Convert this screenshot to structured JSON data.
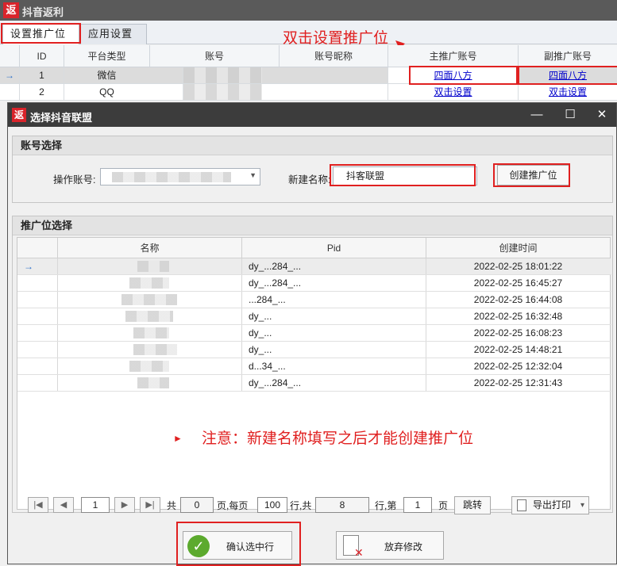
{
  "main": {
    "title": "抖音返利",
    "logo_char": "返",
    "tabs": [
      {
        "label": "设置推广位"
      },
      {
        "label": "应用设置"
      }
    ],
    "annotation_top": "双击设置推广位",
    "columns": [
      "ID",
      "平台类型",
      "账号",
      "账号昵称",
      "主推广账号",
      "副推广账号"
    ],
    "rows": [
      {
        "id": "1",
        "platform": "微信",
        "main_account": "四面八方",
        "sub_account": "四面八方"
      },
      {
        "id": "2",
        "platform": "QQ",
        "main_account": "双击设置",
        "sub_account": "双击设置"
      }
    ],
    "row_arrow": "→"
  },
  "dialog": {
    "title": "选择抖音联盟",
    "logo_char": "返",
    "window_buttons": {
      "minimize": "—",
      "maximize": "☐",
      "close": "✕"
    },
    "account_group": {
      "header": "账号选择",
      "operator_label": "操作账号:",
      "new_name_label": "新建名称:",
      "new_name_value": "抖客联盟",
      "create_button": "创建推广位"
    },
    "slot_group": {
      "header": "推广位选择",
      "columns": [
        "名称",
        "Pid",
        "创建时间"
      ],
      "row_arrow": "→",
      "rows": [
        {
          "pid": "dy_...284_...",
          "time": "2022-02-25 18:01:22"
        },
        {
          "pid": "dy_...284_...",
          "time": "2022-02-25 16:45:27"
        },
        {
          "pid": "...284_...",
          "time": "2022-02-25 16:44:08"
        },
        {
          "pid": "dy_...",
          "time": "2022-02-25 16:32:48"
        },
        {
          "pid": "dy_...",
          "time": "2022-02-25 16:08:23"
        },
        {
          "pid": "dy_...",
          "time": "2022-02-25 14:48:21"
        },
        {
          "pid": "d...34_...",
          "time": "2022-02-25 12:32:04"
        },
        {
          "pid": "dy_...284_...",
          "time": "2022-02-25 12:31:43"
        }
      ],
      "note_marker": "►",
      "note": "注意：新建名称填写之后才能创建推广位"
    },
    "pager": {
      "first": "|◀",
      "prev": "◀",
      "next": "▶",
      "last": "▶|",
      "current_page": "1",
      "total_label": "共",
      "total_pages": "0",
      "per_page_label": "页,每页",
      "per_page": "100",
      "rows_label": "行,共",
      "total_rows": "8",
      "goto_label": "行,第",
      "goto_page": "1",
      "page_label": "页",
      "jump_button": "跳转",
      "export_button": "导出打印",
      "export_arrow": "▾"
    },
    "confirm_button": "确认选中行",
    "discard_button": "放弃修改"
  }
}
